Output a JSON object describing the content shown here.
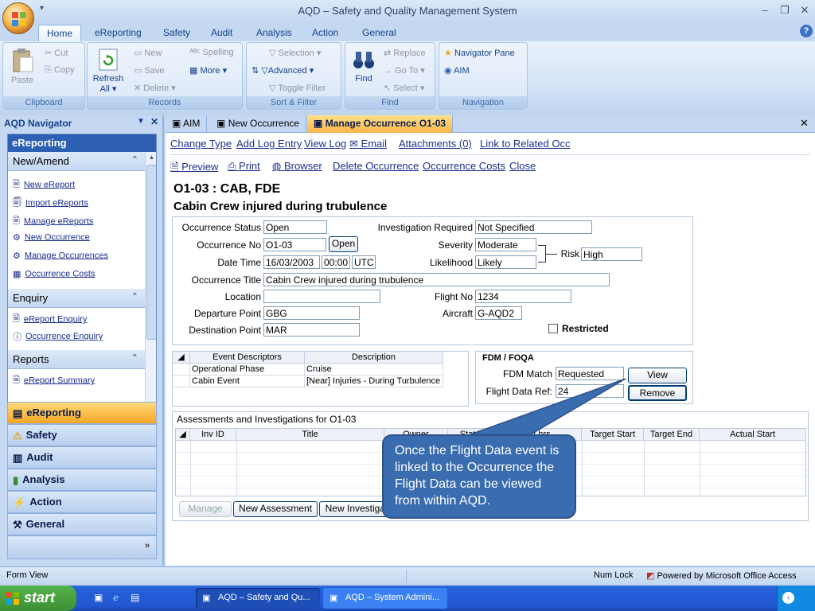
{
  "window": {
    "title": "AQD – Safety and Quality Management System"
  },
  "ribbon": {
    "tabs": [
      "Home",
      "eReporting",
      "Safety",
      "Audit",
      "Analysis",
      "Action",
      "General"
    ],
    "groups": {
      "clipboard": {
        "label": "Clipboard",
        "paste": "Paste",
        "cut": "Cut",
        "copy": "Copy"
      },
      "records": {
        "label": "Records",
        "refresh": "Refresh",
        "refresh2": "All",
        "new": "New",
        "save": "Save",
        "delete": "Delete",
        "spelling": "Spelling",
        "more": "More"
      },
      "sortfilter": {
        "label": "Sort & Filter",
        "selection": "Selection",
        "advanced": "Advanced",
        "toggle": "Toggle Filter"
      },
      "find": {
        "label": "Find",
        "find": "Find",
        "replace": "Replace",
        "goto": "Go To",
        "select": "Select"
      },
      "navigation": {
        "label": "Navigation",
        "navpane": "Navigator Pane",
        "aim": "AIM"
      }
    }
  },
  "navigator": {
    "header": "AQD Navigator",
    "title": "eReporting",
    "sections": [
      {
        "label": "New/Amend",
        "items": [
          "New eReport",
          "Import eReports",
          "Manage eReports",
          "New Occurrence",
          "Manage Occurrences",
          "Occurrence Costs"
        ]
      },
      {
        "label": "Enquiry",
        "items": [
          "eReport Enquiry",
          "Occurrence Enquiry"
        ]
      },
      {
        "label": "Reports",
        "items": [
          "eReport Summary"
        ]
      }
    ],
    "bigbuttons": [
      "eReporting",
      "Safety",
      "Audit",
      "Analysis",
      "Action",
      "General"
    ]
  },
  "doctabs": [
    "AIM",
    "New Occurrence",
    "Manage Occurrence O1-03"
  ],
  "toolbar1": [
    "Change Type",
    "Add Log Entry",
    "View Log",
    "Email",
    "Attachments (0)",
    "Link to Related Occ"
  ],
  "toolbar2": [
    "Preview",
    "Print",
    "Browser",
    "Delete Occurrence",
    "Occurrence Costs",
    "Close"
  ],
  "form": {
    "heading1": "O1-03 : CAB, FDE",
    "heading2": "Cabin Crew injured during trubulence",
    "labels": {
      "status": "Occurrence Status",
      "invreq": "Investigation Required",
      "occno": "Occurrence No",
      "severity": "Severity",
      "datetime": "Date Time",
      "likelihood": "Likelihood",
      "risk": "Risk",
      "title": "Occurrence Title",
      "location": "Location",
      "flightno": "Flight No",
      "dep": "Departure Point",
      "aircraft": "Aircraft",
      "dest": "Destination Point",
      "restricted": "Restricted"
    },
    "values": {
      "status": "Open",
      "invreq": "Not Specified",
      "occno": "O1-03",
      "open_btn": "Open",
      "severity": "Moderate",
      "date": "16/03/2003",
      "time": "00:00",
      "tz": "UTC",
      "likelihood": "Likely",
      "risk": "High",
      "title": "Cabin Crew injured during trubulence",
      "location": "",
      "flightno": "1234",
      "dep": "GBG",
      "aircraft": "G-AQD2",
      "dest": "MAR"
    },
    "events": {
      "headers": [
        "Event Descriptors",
        "Description"
      ],
      "rows": [
        [
          "Operational Phase",
          "Cruise"
        ],
        [
          "Cabin Event",
          "[Near] Injuries - During Turbulence"
        ]
      ]
    },
    "fdm": {
      "title": "FDM / FOQA",
      "match_label": "FDM Match",
      "match": "Requested",
      "ref_label": "Flight Data Ref:",
      "ref": "24",
      "view": "View",
      "remove": "Remove"
    },
    "assess": {
      "title": "Assessments and Investigations for O1-03",
      "headers": [
        "Inv ID",
        "Title",
        "Owner",
        "State",
        "Est hrs",
        "Target Start",
        "Target End",
        "Actual Start"
      ],
      "buttons": [
        "Manage",
        "New Assessment",
        "New Investigation"
      ]
    }
  },
  "callout": "Once the Flight Data event is linked to the Occurrence the Flight Data can be viewed from within AQD.",
  "status": {
    "left": "Form View",
    "numlock": "Num Lock",
    "powered": "Powered by Microsoft Office Access"
  },
  "taskbar": {
    "start": "start",
    "tasks": [
      "AQD – Safety and Qu...",
      "AQD – System Admini..."
    ]
  }
}
